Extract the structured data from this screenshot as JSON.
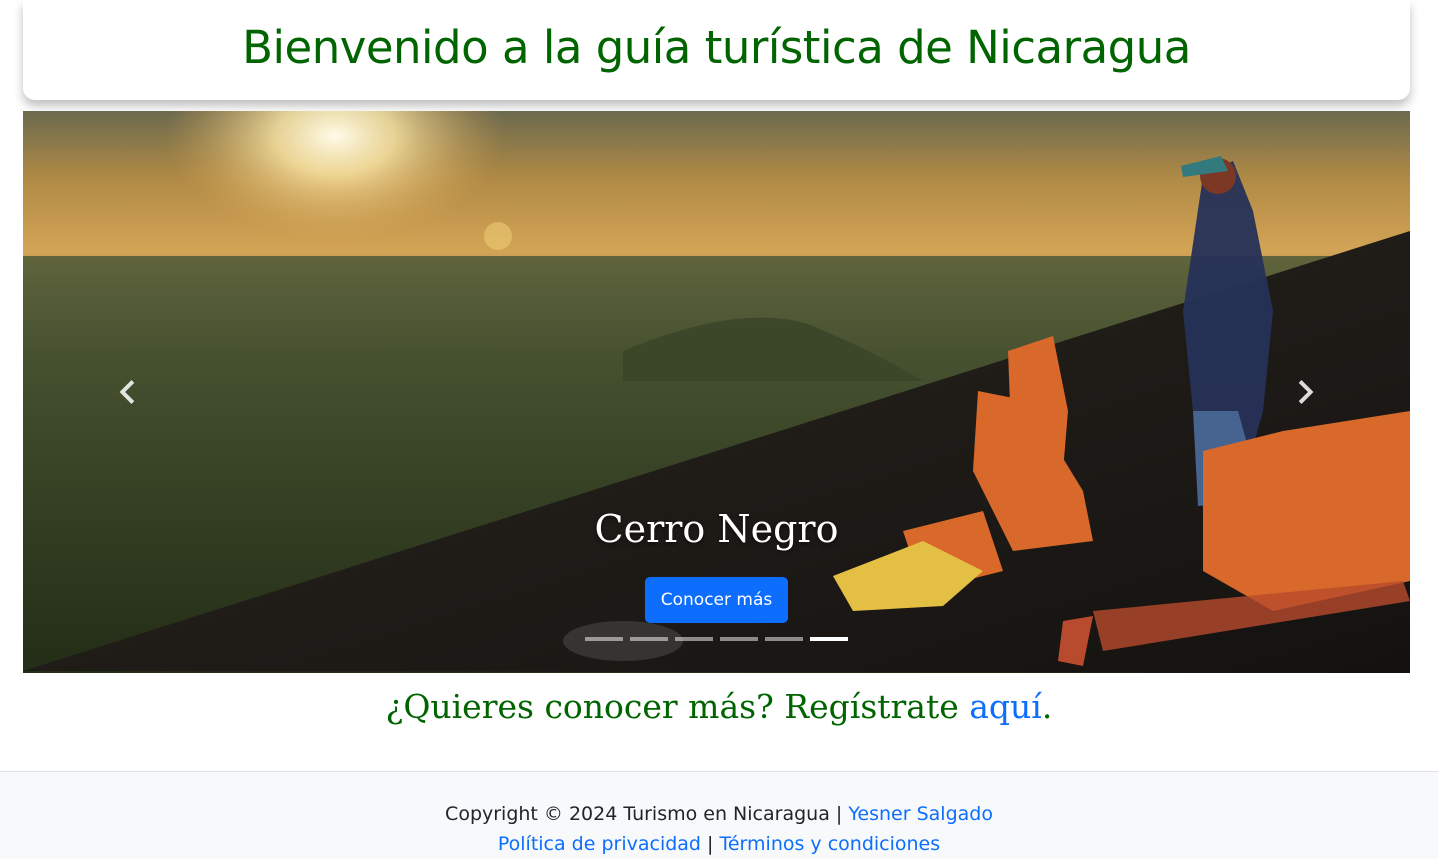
{
  "header": {
    "title": "Bienvenido a la guía turística de Nicaragua",
    "title_color": "#006400"
  },
  "carousel": {
    "slide_title": "Cerro Negro",
    "button_label": "Conocer más",
    "button_color": "#0d6efd",
    "prev_icon": "chevron-left-icon",
    "next_icon": "chevron-right-icon",
    "slide_count": 6,
    "active_index": 5
  },
  "cta": {
    "text": "¿Quieres conocer más? Regístrate ",
    "link_text": "aquí",
    "suffix": "."
  },
  "footer": {
    "copyright": "Copyright © 2024 Turismo en Nicaragua | ",
    "author_link": "Yesner Salgado",
    "privacy_link": "Política de privacidad",
    "separator": " | ",
    "terms_link": "Términos y condiciones",
    "link_color": "#0d6efd"
  }
}
